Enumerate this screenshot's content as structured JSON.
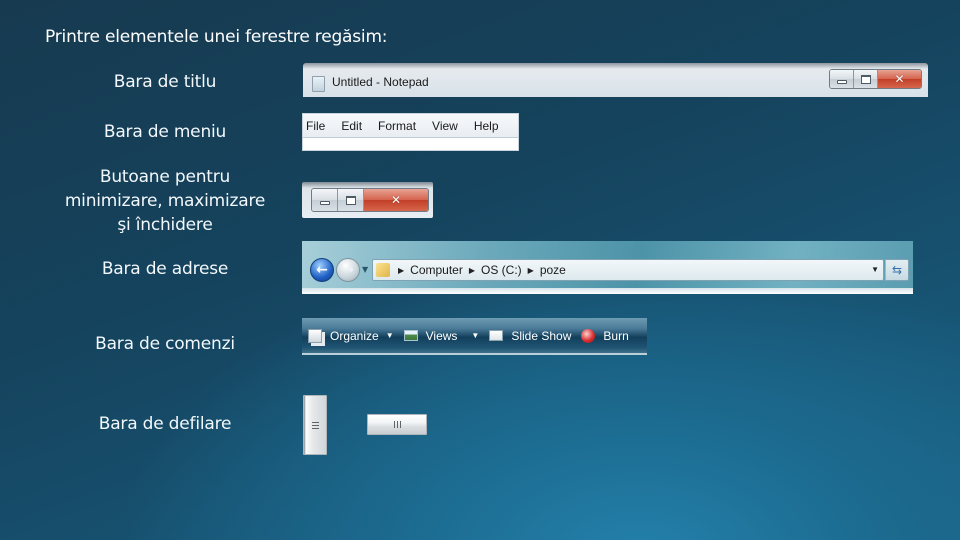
{
  "heading": "Printre elementele unei ferestre regăsim:",
  "labels": {
    "title_bar": "Bara de titlu",
    "menu_bar": "Bara de meniu",
    "buttons_line1": "Butoane pentru",
    "buttons_line2": "minimizare, maximizare",
    "buttons_line3": "şi închidere",
    "address_bar": "Bara de adrese",
    "command_bar": "Bara de comenzi",
    "scroll_bar": "Bara de defilare"
  },
  "title_bar": {
    "icon": "notepad-icon",
    "title": "Untitled - Notepad",
    "buttons": {
      "minimize": "minimize-icon",
      "maximize": "maximize-icon",
      "close": "✕"
    }
  },
  "menu_bar": {
    "items": [
      "File",
      "Edit",
      "Format",
      "View",
      "Help"
    ]
  },
  "caption_buttons": {
    "minimize": "minimize-icon",
    "maximize": "maximize-icon",
    "close": "✕"
  },
  "address_bar": {
    "back": "←",
    "forward": "→",
    "history": "▼",
    "separator": "▶",
    "breadcrumbs": [
      "Computer",
      "OS (C:)",
      "poze"
    ],
    "dropdown": "▼",
    "refresh": "⇆"
  },
  "command_bar": {
    "caret": "▼",
    "items": [
      {
        "label": "Organize",
        "icon": "organize-icon",
        "has_dropdown": true
      },
      {
        "label": "Views",
        "icon": "views-icon",
        "has_dropdown": true
      },
      {
        "label": "Slide Show",
        "icon": "slideshow-icon",
        "has_dropdown": false
      },
      {
        "label": "Burn",
        "icon": "burn-icon",
        "has_dropdown": false
      }
    ]
  },
  "colors": {
    "background_dark": "#15435d",
    "background_light": "#2381ab",
    "close_button": "#c23f27",
    "command_bar": "#123f5c"
  }
}
